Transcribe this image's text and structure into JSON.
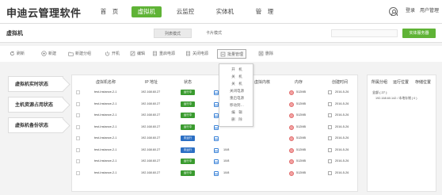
{
  "app": {
    "title": "申迪云管理软件"
  },
  "nav": [
    {
      "label": "首　页"
    },
    {
      "label": "虚拟机"
    },
    {
      "label": "云监控"
    },
    {
      "label": "实体机"
    },
    {
      "label": "管　理"
    }
  ],
  "user": {
    "login": "登录",
    "user_management": "用户管理"
  },
  "subheader": {
    "title": "虚拟机",
    "tab_list": "列表模式",
    "tab_card": "卡片模式",
    "search_button": "实体服务器",
    "search_placeholder": ""
  },
  "toolbar": [
    {
      "label": "刷新",
      "icon": "refresh-icon"
    },
    {
      "label": "新建",
      "icon": "plus-icon"
    },
    {
      "label": "新建分组",
      "icon": "folder-icon"
    },
    {
      "label": "开机",
      "icon": "power-icon"
    },
    {
      "label": "编辑",
      "icon": "edit-icon"
    },
    {
      "label": "重启电源",
      "icon": "restart-icon"
    },
    {
      "label": "关闭电源",
      "icon": "shutdown-icon"
    },
    {
      "label": "批量管理",
      "icon": "batch-icon"
    },
    {
      "label": "删除",
      "icon": "delete-icon"
    }
  ],
  "left_menu": [
    {
      "label": "虚拟机实时状态"
    },
    {
      "label": "主机资源占用状态"
    },
    {
      "label": "虚拟机备份状态"
    }
  ],
  "table": {
    "headers": [
      "虚拟机名称",
      "IP 地址",
      "状态",
      "",
      "虚拟内核",
      "内存",
      "创建时间"
    ],
    "rows": [
      {
        "name": "test-Instance-2-1",
        "ip": "192.168.60.27",
        "status": "运行中",
        "disk": "",
        "mem": "512MB",
        "date": "2016-5-26"
      },
      {
        "name": "test-Instance-2-1",
        "ip": "192.168.60.27",
        "status": "运行中",
        "disk": "",
        "mem": "512MB",
        "date": "2016-5-26"
      },
      {
        "name": "test-Instance-2-1",
        "ip": "192.168.60.27",
        "status": "运行中",
        "disk": "",
        "mem": "512MB",
        "date": "2016-5-26"
      },
      {
        "name": "test-Instance-2-1",
        "ip": "192.168.60.27",
        "status": "运行中",
        "disk": "",
        "mem": "512MB",
        "date": "2016-5-26"
      },
      {
        "name": "test-Instance-2-1",
        "ip": "192.168.60.27",
        "status": "未运行",
        "disk": "",
        "mem": "512MB",
        "date": "2016-5-26"
      },
      {
        "name": "test-Instance-2-1",
        "ip": "192.168.60.27",
        "status": "未运行",
        "disk": "10/8",
        "mem": "512MB",
        "date": "2016-5-26"
      },
      {
        "name": "test-Instance-2-1",
        "ip": "192.168.60.27",
        "status": "运行中",
        "disk": "10/8",
        "mem": "512MB",
        "date": "2016-5-26"
      },
      {
        "name": "test-Instance-2-1",
        "ip": "192.168.60.27",
        "status": "运行中",
        "disk": "10/8",
        "mem": "512MB",
        "date": "2016-5-26"
      }
    ]
  },
  "context_menu": [
    "开　机",
    "关　机",
    "关　机",
    "关闭电源",
    "重启电源",
    "移动到…",
    "编　辑",
    "删　除"
  ],
  "right_panel": {
    "tabs": [
      "所属分组",
      "运行位置",
      "存储位置"
    ],
    "line1": "全部 ( 27 )",
    "line2": "192.168.60.142 / 本地存储 ( 0 )"
  },
  "colors": {
    "accent": "#5fb336",
    "running": "#3a9b2f",
    "stopped": "#2b6fc4"
  }
}
